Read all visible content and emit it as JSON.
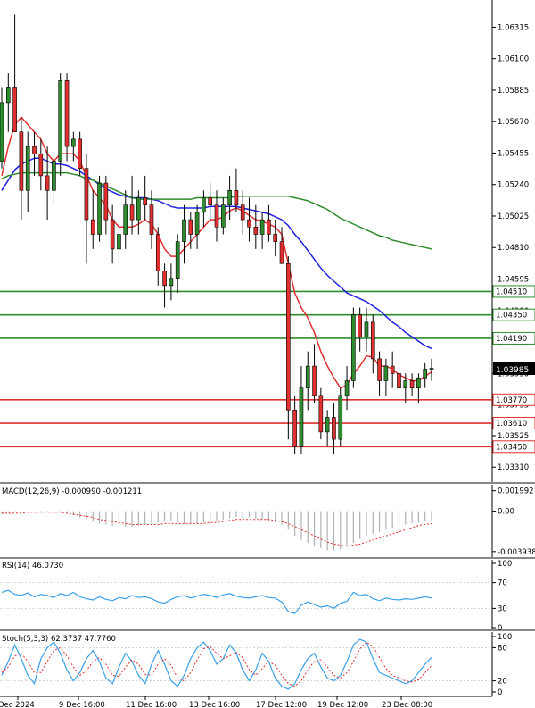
{
  "chart_data": [
    {
      "type": "candlestick",
      "panel": "main",
      "ylim": [
        1.0322,
        1.0647
      ],
      "y_ticks": [
        "1.06315",
        "1.06100",
        "1.05885",
        "1.05670",
        "1.05455",
        "1.05240",
        "1.05025",
        "1.04810",
        "1.04595",
        "1.04380",
        "1.04165",
        "1.03950",
        "1.03735",
        "1.03525",
        "1.03310"
      ],
      "current_price": "1.03985",
      "levels": [
        {
          "label": "1.04510",
          "value": 1.0451,
          "color": "#2e8b2e"
        },
        {
          "label": "1.04350",
          "value": 1.0435,
          "color": "#2e8b2e"
        },
        {
          "label": "1.04190",
          "value": 1.0419,
          "color": "#2e8b2e"
        },
        {
          "label": "1.03770",
          "value": 1.0377,
          "color": "#e03030"
        },
        {
          "label": "1.03610",
          "value": 1.0361,
          "color": "#e03030"
        },
        {
          "label": "1.03450",
          "value": 1.0345,
          "color": "#e03030"
        }
      ],
      "candles": [
        [
          1.054,
          1.059,
          1.0535,
          1.058
        ],
        [
          1.058,
          1.06,
          1.056,
          1.059
        ],
        [
          1.059,
          1.064,
          1.057,
          1.056
        ],
        [
          1.056,
          1.057,
          1.05,
          1.052
        ],
        [
          1.052,
          1.056,
          1.0505,
          1.055
        ],
        [
          1.055,
          1.056,
          1.053,
          1.0545
        ],
        [
          1.0545,
          1.0555,
          1.052,
          1.053
        ],
        [
          1.053,
          1.055,
          1.05,
          1.052
        ],
        [
          1.052,
          1.0545,
          1.051,
          1.054
        ],
        [
          1.054,
          1.06,
          1.053,
          1.0595
        ],
        [
          1.0595,
          1.06,
          1.054,
          1.055
        ],
        [
          1.055,
          1.056,
          1.054,
          1.0555
        ],
        [
          1.0555,
          1.056,
          1.053,
          1.0535
        ],
        [
          1.0535,
          1.0545,
          1.047,
          1.05
        ],
        [
          1.05,
          1.052,
          1.048,
          1.049
        ],
        [
          1.049,
          1.053,
          1.0485,
          1.0525
        ],
        [
          1.0525,
          1.053,
          1.049,
          1.05
        ],
        [
          1.05,
          1.051,
          1.047,
          1.048
        ],
        [
          1.048,
          1.05,
          1.047,
          1.049
        ],
        [
          1.049,
          1.052,
          1.048,
          1.051
        ],
        [
          1.051,
          1.053,
          1.049,
          1.05
        ],
        [
          1.05,
          1.052,
          1.049,
          1.0515
        ],
        [
          1.0515,
          1.053,
          1.05,
          1.051
        ],
        [
          1.051,
          1.052,
          1.048,
          1.049
        ],
        [
          1.049,
          1.0495,
          1.0455,
          1.0465
        ],
        [
          1.0465,
          1.047,
          1.044,
          1.0455
        ],
        [
          1.0455,
          1.047,
          1.0445,
          1.046
        ],
        [
          1.046,
          1.049,
          1.045,
          1.0485
        ],
        [
          1.0485,
          1.051,
          1.047,
          1.05
        ],
        [
          1.05,
          1.0505,
          1.048,
          1.049
        ],
        [
          1.049,
          1.051,
          1.048,
          1.0505
        ],
        [
          1.0505,
          1.052,
          1.0495,
          1.0515
        ],
        [
          1.0515,
          1.0525,
          1.05,
          1.051
        ],
        [
          1.051,
          1.052,
          1.0485,
          1.0495
        ],
        [
          1.0495,
          1.0515,
          1.049,
          1.051
        ],
        [
          1.051,
          1.053,
          1.05,
          1.052
        ],
        [
          1.052,
          1.0535,
          1.0505,
          1.051
        ],
        [
          1.051,
          1.052,
          1.049,
          1.05
        ],
        [
          1.05,
          1.0515,
          1.0485,
          1.0495
        ],
        [
          1.0495,
          1.051,
          1.048,
          1.049
        ],
        [
          1.049,
          1.0505,
          1.048,
          1.05
        ],
        [
          1.05,
          1.051,
          1.0485,
          1.049
        ],
        [
          1.049,
          1.05,
          1.0475,
          1.0485
        ],
        [
          1.0485,
          1.0495,
          1.047,
          1.047
        ],
        [
          1.047,
          1.0475,
          1.035,
          1.037
        ],
        [
          1.037,
          1.038,
          1.034,
          1.0345
        ],
        [
          1.0345,
          1.04,
          1.034,
          1.0385
        ],
        [
          1.0385,
          1.041,
          1.037,
          1.04
        ],
        [
          1.04,
          1.0415,
          1.0375,
          1.038
        ],
        [
          1.038,
          1.0385,
          1.035,
          1.0355
        ],
        [
          1.0355,
          1.037,
          1.0345,
          1.0365
        ],
        [
          1.0365,
          1.0375,
          1.034,
          1.035
        ],
        [
          1.035,
          1.0385,
          1.0345,
          1.038
        ],
        [
          1.038,
          1.04,
          1.037,
          1.039
        ],
        [
          1.039,
          1.044,
          1.0385,
          1.0435
        ],
        [
          1.0435,
          1.044,
          1.041,
          1.042
        ],
        [
          1.042,
          1.044,
          1.041,
          1.043
        ],
        [
          1.043,
          1.0435,
          1.0395,
          1.0405
        ],
        [
          1.0405,
          1.041,
          1.038,
          1.039
        ],
        [
          1.039,
          1.0405,
          1.038,
          1.04
        ],
        [
          1.04,
          1.041,
          1.0385,
          1.0395
        ],
        [
          1.0395,
          1.04,
          1.038,
          1.0385
        ],
        [
          1.0385,
          1.0395,
          1.0375,
          1.039
        ],
        [
          1.039,
          1.0395,
          1.038,
          1.0385
        ],
        [
          1.0385,
          1.0395,
          1.0375,
          1.0392
        ],
        [
          1.0392,
          1.0402,
          1.0385,
          1.0398
        ],
        [
          1.0398,
          1.0405,
          1.039,
          1.03985
        ]
      ],
      "ma_series": [
        {
          "color": "#e03030",
          "values": [
            1.053,
            1.055,
            1.0565,
            1.057,
            1.0565,
            1.056,
            1.0555,
            1.0545,
            1.054,
            1.0545,
            1.0545,
            1.0545,
            1.054,
            1.053,
            1.052,
            1.0515,
            1.051,
            1.05,
            1.0495,
            1.0495,
            1.0495,
            1.0497,
            1.05,
            1.0497,
            1.049,
            1.048,
            1.0475,
            1.0475,
            1.048,
            1.0485,
            1.049,
            1.0495,
            1.05,
            1.05,
            1.0502,
            1.0506,
            1.0508,
            1.0506,
            1.0503,
            1.05,
            1.0499,
            1.0497,
            1.0495,
            1.049,
            1.047,
            1.045,
            1.044,
            1.0433,
            1.0423,
            1.041,
            1.04,
            1.0392,
            1.0385,
            1.0387,
            1.0395,
            1.04,
            1.0407,
            1.0406,
            1.04,
            1.04,
            1.0398,
            1.0394,
            1.0392,
            1.039,
            1.039,
            1.0393,
            1.0396
          ]
        },
        {
          "color": "#2020e0",
          "values": [
            1.052,
            1.0527,
            1.0534,
            1.0538,
            1.054,
            1.0542,
            1.0542,
            1.054,
            1.0538,
            1.0538,
            1.0537,
            1.0535,
            1.0533,
            1.053,
            1.0527,
            1.0524,
            1.0521,
            1.0519,
            1.0517,
            1.0516,
            1.0515,
            1.0515,
            1.0515,
            1.0514,
            1.0513,
            1.0511,
            1.0509,
            1.0508,
            1.0508,
            1.0508,
            1.0508,
            1.0508,
            1.0509,
            1.0509,
            1.0509,
            1.0509,
            1.0509,
            1.0508,
            1.0507,
            1.0506,
            1.0505,
            1.0504,
            1.0502,
            1.05,
            1.0496,
            1.049,
            1.0485,
            1.0479,
            1.0473,
            1.0467,
            1.0462,
            1.0458,
            1.0454,
            1.045,
            1.0448,
            1.0446,
            1.0444,
            1.0441,
            1.0438,
            1.0434,
            1.043,
            1.0427,
            1.0423,
            1.042,
            1.0417,
            1.0414,
            1.0412
          ]
        },
        {
          "color": "#2e8b2e",
          "values": [
            1.0528,
            1.053,
            1.0531,
            1.0532,
            1.0532,
            1.0532,
            1.0532,
            1.0532,
            1.0532,
            1.0532,
            1.0532,
            1.0531,
            1.053,
            1.0528,
            1.0527,
            1.0525,
            1.0523,
            1.0521,
            1.0519,
            1.0517,
            1.0515,
            1.0514,
            1.0514,
            1.0514,
            1.0514,
            1.0514,
            1.0514,
            1.0514,
            1.0514,
            1.0514,
            1.0515,
            1.0515,
            1.0515,
            1.0515,
            1.0515,
            1.0515,
            1.0516,
            1.0516,
            1.0516,
            1.0516,
            1.0516,
            1.0516,
            1.0516,
            1.0516,
            1.0516,
            1.0515,
            1.0514,
            1.0513,
            1.0511,
            1.0509,
            1.0507,
            1.0504,
            1.0501,
            1.0499,
            1.0497,
            1.0495,
            1.0493,
            1.0491,
            1.0489,
            1.0488,
            1.0486,
            1.0485,
            1.0484,
            1.0483,
            1.0482,
            1.0481,
            1.048
          ]
        }
      ],
      "x_ticks": [
        "Dec 2024",
        "9 Dec 16:00",
        "11 Dec 16:00",
        "13 Dec 16:00",
        "17 Dec 12:00",
        "19 Dec 12:00",
        "23 Dec 08:00"
      ],
      "grid": false
    },
    {
      "type": "bar",
      "panel": "macd",
      "title": "MACD(12,26,9) -0.000990 -0.001211",
      "ylim": [
        -0.0043,
        0.0024
      ],
      "y_ticks": [
        "0.001992",
        "0.00",
        "-0.003938"
      ],
      "histogram": [
        -0.0003,
        -0.0002,
        -0.0001,
        -0.0001,
        0,
        0,
        -0.0001,
        -0.0001,
        -0.0001,
        -0.0001,
        -0.0002,
        -0.0004,
        -0.0006,
        -0.0008,
        -0.001,
        -0.0012,
        -0.0013,
        -0.0014,
        -0.0014,
        -0.0015,
        -0.0015,
        -0.0014,
        -0.0013,
        -0.0012,
        -0.0011,
        -0.001,
        -0.001,
        -0.0011,
        -0.0012,
        -0.0012,
        -0.0012,
        -0.0011,
        -0.001,
        -0.0009,
        -0.0008,
        -0.0007,
        -0.0006,
        -0.0006,
        -0.0006,
        -0.0007,
        -0.0008,
        -0.0009,
        -0.0011,
        -0.0013,
        -0.0018,
        -0.0024,
        -0.0028,
        -0.0031,
        -0.0034,
        -0.0036,
        -0.0038,
        -0.0038,
        -0.0037,
        -0.0035,
        -0.0031,
        -0.0027,
        -0.0024,
        -0.0022,
        -0.002,
        -0.0018,
        -0.0016,
        -0.0014,
        -0.0013,
        -0.0012,
        -0.0011,
        -0.001,
        -0.00099
      ],
      "signal": [
        -0.0002,
        -0.0002,
        -0.0002,
        -0.0002,
        -0.0001,
        -0.0001,
        -0.0001,
        -0.0001,
        -0.0001,
        -0.0001,
        -0.0002,
        -0.0003,
        -0.0004,
        -0.0005,
        -0.0006,
        -0.0008,
        -0.0009,
        -0.001,
        -0.0011,
        -0.0012,
        -0.0013,
        -0.0013,
        -0.0013,
        -0.0013,
        -0.0013,
        -0.0012,
        -0.0012,
        -0.0012,
        -0.0012,
        -0.0012,
        -0.0012,
        -0.0012,
        -0.0011,
        -0.0011,
        -0.001,
        -0.0009,
        -0.0008,
        -0.0008,
        -0.0008,
        -0.0008,
        -0.0008,
        -0.0008,
        -0.0009,
        -0.001,
        -0.0012,
        -0.0015,
        -0.0018,
        -0.0021,
        -0.0024,
        -0.0027,
        -0.003,
        -0.0032,
        -0.0033,
        -0.0034,
        -0.0033,
        -0.0032,
        -0.003,
        -0.0028,
        -0.0026,
        -0.0024,
        -0.0022,
        -0.002,
        -0.0018,
        -0.0016,
        -0.0014,
        -0.0013,
        -0.001211
      ]
    },
    {
      "type": "line",
      "panel": "rsi",
      "title": "RSI(14) 46.0730",
      "ylim": [
        0,
        100
      ],
      "y_ticks": [
        "100",
        "70",
        "30",
        "0"
      ],
      "values": [
        55,
        58,
        52,
        50,
        54,
        48,
        52,
        50,
        47,
        53,
        50,
        55,
        48,
        45,
        43,
        48,
        44,
        42,
        47,
        45,
        50,
        47,
        48,
        45,
        40,
        38,
        44,
        48,
        50,
        46,
        49,
        52,
        50,
        47,
        51,
        53,
        49,
        47,
        46,
        48,
        50,
        47,
        46,
        40,
        25,
        22,
        35,
        40,
        36,
        32,
        34,
        30,
        38,
        41,
        55,
        50,
        52,
        45,
        42,
        46,
        44,
        43,
        45,
        44,
        46,
        48,
        46.07
      ]
    },
    {
      "type": "line",
      "panel": "stoch",
      "title": "Stoch(5,3,3) 62.3737 47.7760",
      "ylim": [
        0,
        100
      ],
      "y_ticks": [
        "100",
        "80",
        "20",
        "0"
      ],
      "k": [
        30,
        55,
        85,
        60,
        30,
        15,
        60,
        80,
        90,
        70,
        40,
        20,
        35,
        60,
        75,
        55,
        25,
        15,
        45,
        70,
        55,
        30,
        15,
        50,
        75,
        50,
        20,
        10,
        30,
        60,
        80,
        90,
        75,
        50,
        60,
        85,
        70,
        40,
        20,
        40,
        70,
        55,
        25,
        10,
        5,
        15,
        40,
        60,
        70,
        45,
        25,
        20,
        30,
        55,
        85,
        95,
        90,
        60,
        35,
        30,
        25,
        20,
        15,
        20,
        35,
        50,
        62.37
      ],
      "d": [
        35,
        45,
        65,
        70,
        55,
        35,
        35,
        55,
        75,
        80,
        65,
        45,
        30,
        38,
        55,
        62,
        50,
        30,
        28,
        45,
        58,
        50,
        32,
        30,
        50,
        60,
        48,
        25,
        20,
        35,
        58,
        78,
        82,
        70,
        60,
        65,
        72,
        62,
        40,
        30,
        42,
        55,
        48,
        30,
        15,
        10,
        20,
        40,
        55,
        58,
        45,
        30,
        25,
        35,
        55,
        78,
        90,
        82,
        62,
        42,
        30,
        25,
        20,
        18,
        22,
        35,
        47.78
      ]
    }
  ]
}
